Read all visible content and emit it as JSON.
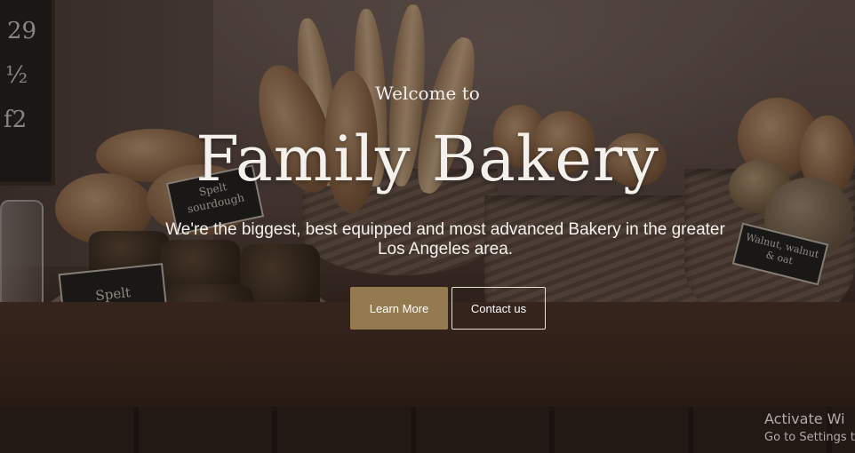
{
  "hero": {
    "welcome": "Welcome to",
    "title": "Family Bakery",
    "subtitle": "We're the biggest, best equipped and most advanced Bakery in the greater Los Angeles area.",
    "primary_button": "Learn More",
    "secondary_button": "Contact us"
  },
  "signs": [
    {
      "label": "Spelt sourdough"
    },
    {
      "label": "Spelt soda"
    },
    {
      "label": "Walnut, walnut & oat"
    }
  ],
  "watermark": {
    "line1": "Activate Wi",
    "line2": "Go to Settings t"
  },
  "colors": {
    "primary_button": "#937a4f",
    "text": "#f4f1ec"
  }
}
